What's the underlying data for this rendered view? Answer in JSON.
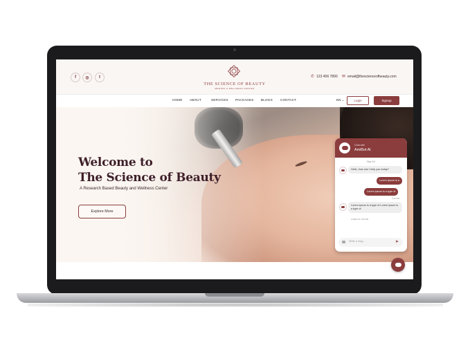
{
  "header": {
    "social": [
      "f",
      "◎",
      "t"
    ],
    "logo_title": "THE SCIENCE OF BEAUTY",
    "logo_subtitle": "MEDSPA & WELLNESS CENTER",
    "phone": "123 456 7890",
    "email": "email@thescienceofbeauty.com"
  },
  "nav": {
    "items": [
      "HOME",
      "ABOUT",
      "SERVICES",
      "PACKAGES",
      "BLOGS",
      "CONTACT"
    ],
    "language": "EN",
    "login": "Login",
    "signup": "Signup"
  },
  "hero": {
    "title_line1": "Welcome to",
    "title_line2": "The Science of Beauty",
    "subtitle": "A Research Based Beauty and Wellness Center",
    "cta": "Explore More"
  },
  "chat": {
    "subtitle": "Chat with",
    "bot_name": "AmiBot AI",
    "date": "Nov 13",
    "messages": [
      {
        "from": "bot",
        "text": "Hello, how can I help you today?"
      },
      {
        "from": "user",
        "text": "Lorem ipsum is a"
      },
      {
        "from": "user",
        "text": "Lorem ipsum is a type of"
      },
      {
        "from": "bot",
        "text": "Lorem ipsum is a type of Lorem ipsum is a type of"
      }
    ],
    "time_sent": "4:10 PM",
    "bot_footer": "AmiBot AI  4:30 PM",
    "input_placeholder": "Write a msg..."
  },
  "colors": {
    "brand": "#8b3c3c",
    "title": "#3e1f2a"
  }
}
